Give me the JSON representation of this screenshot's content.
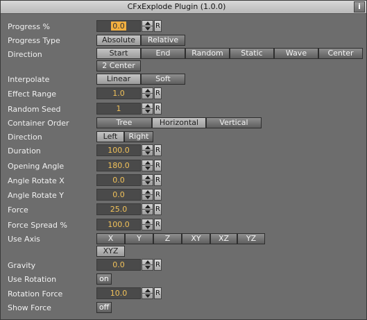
{
  "title": "CFxExplode Plugin (1.0.0)",
  "info_label": "i",
  "reset_label": "R",
  "progress": {
    "label": "Progress %",
    "value": "0.0"
  },
  "progress_type": {
    "label": "Progress Type",
    "options": [
      "Absolute",
      "Relative"
    ],
    "selected": "Absolute"
  },
  "direction": {
    "label": "Direction",
    "options": [
      "Start",
      "End",
      "Random",
      "Static",
      "Wave",
      "Center",
      "2 Center"
    ],
    "selected": "Start"
  },
  "interpolate": {
    "label": "Interpolate",
    "options": [
      "Linear",
      "Soft"
    ],
    "selected": "Linear"
  },
  "effect_range": {
    "label": "Effect Range",
    "value": "1.0"
  },
  "random_seed": {
    "label": "Random Seed",
    "value": "1"
  },
  "container_order": {
    "label": "Container Order",
    "options": [
      "Tree",
      "Horizontal",
      "Vertical"
    ],
    "selected": "Horizontal"
  },
  "direction2": {
    "label": "Direction",
    "options": [
      "Left",
      "Right"
    ],
    "selected": "Left"
  },
  "duration": {
    "label": "Duration",
    "value": "100.0"
  },
  "opening_angle": {
    "label": "Opening Angle",
    "value": "180.0"
  },
  "angle_rotate_x": {
    "label": "Angle Rotate X",
    "value": "0.0"
  },
  "angle_rotate_y": {
    "label": "Angle Rotate Y",
    "value": "0.0"
  },
  "force": {
    "label": "Force",
    "value": "25.0"
  },
  "force_spread": {
    "label": "Force Spread %",
    "value": "100.0"
  },
  "use_axis": {
    "label": "Use Axis",
    "options": [
      "X",
      "Y",
      "Z",
      "XY",
      "XZ",
      "YZ",
      "XYZ"
    ],
    "selected": "XYZ"
  },
  "gravity": {
    "label": "Gravity",
    "value": "0.0"
  },
  "use_rotation": {
    "label": "Use Rotation",
    "value": "on"
  },
  "rotation_force": {
    "label": "Rotation Force",
    "value": "10.0"
  },
  "show_force": {
    "label": "Show Force",
    "value": "off"
  }
}
